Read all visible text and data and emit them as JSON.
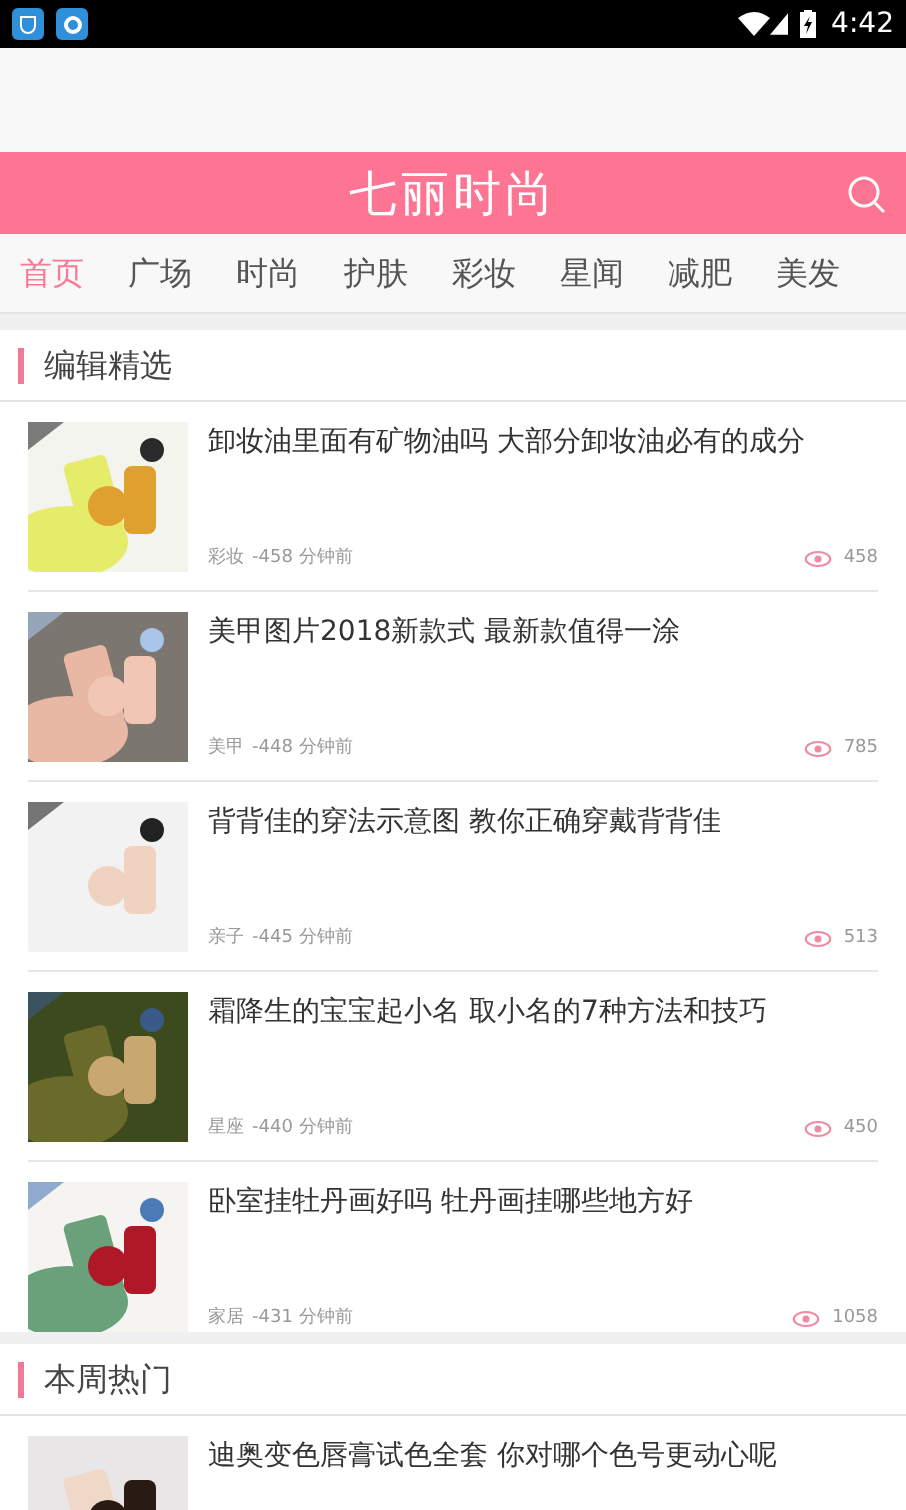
{
  "status_bar": {
    "time": "4:42"
  },
  "header": {
    "title": "七丽时尚"
  },
  "tabs": [
    {
      "label": "首页",
      "selected": true
    },
    {
      "label": "广场",
      "selected": false
    },
    {
      "label": "时尚",
      "selected": false
    },
    {
      "label": "护肤",
      "selected": false
    },
    {
      "label": "彩妆",
      "selected": false
    },
    {
      "label": "星闻",
      "selected": false
    },
    {
      "label": "减肥",
      "selected": false
    },
    {
      "label": "美发",
      "selected": false
    }
  ],
  "sections": [
    {
      "title": "编辑精选",
      "articles": [
        {
          "title": "卸妆油里面有矿物油吗 大部分卸妆油必有的成分",
          "category": "彩妆",
          "time": "-458 分钟前",
          "views": "458",
          "kind": "picture"
        },
        {
          "title": "美甲图片2018新款式 最新款值得一涂",
          "category": "美甲",
          "time": "-448 分钟前",
          "views": "785",
          "kind": "picture"
        },
        {
          "title": "背背佳的穿法示意图 教你正确穿戴背背佳",
          "category": "亲子",
          "time": "-445 分钟前",
          "views": "513",
          "kind": "picture"
        },
        {
          "title": "霜降生的宝宝起小名 取小名的7种方法和技巧",
          "category": "星座",
          "time": "-440 分钟前",
          "views": "450",
          "kind": "picture"
        },
        {
          "title": "卧室挂牡丹画好吗 牡丹画挂哪些地方好",
          "category": "家居",
          "time": "-431 分钟前",
          "views": "1058",
          "kind": "picture"
        }
      ]
    },
    {
      "title": "本周热门",
      "articles": [
        {
          "title": "迪奥变色唇膏试色全套 你对哪个色号更动心呢",
          "kind": "picture"
        }
      ]
    }
  ]
}
